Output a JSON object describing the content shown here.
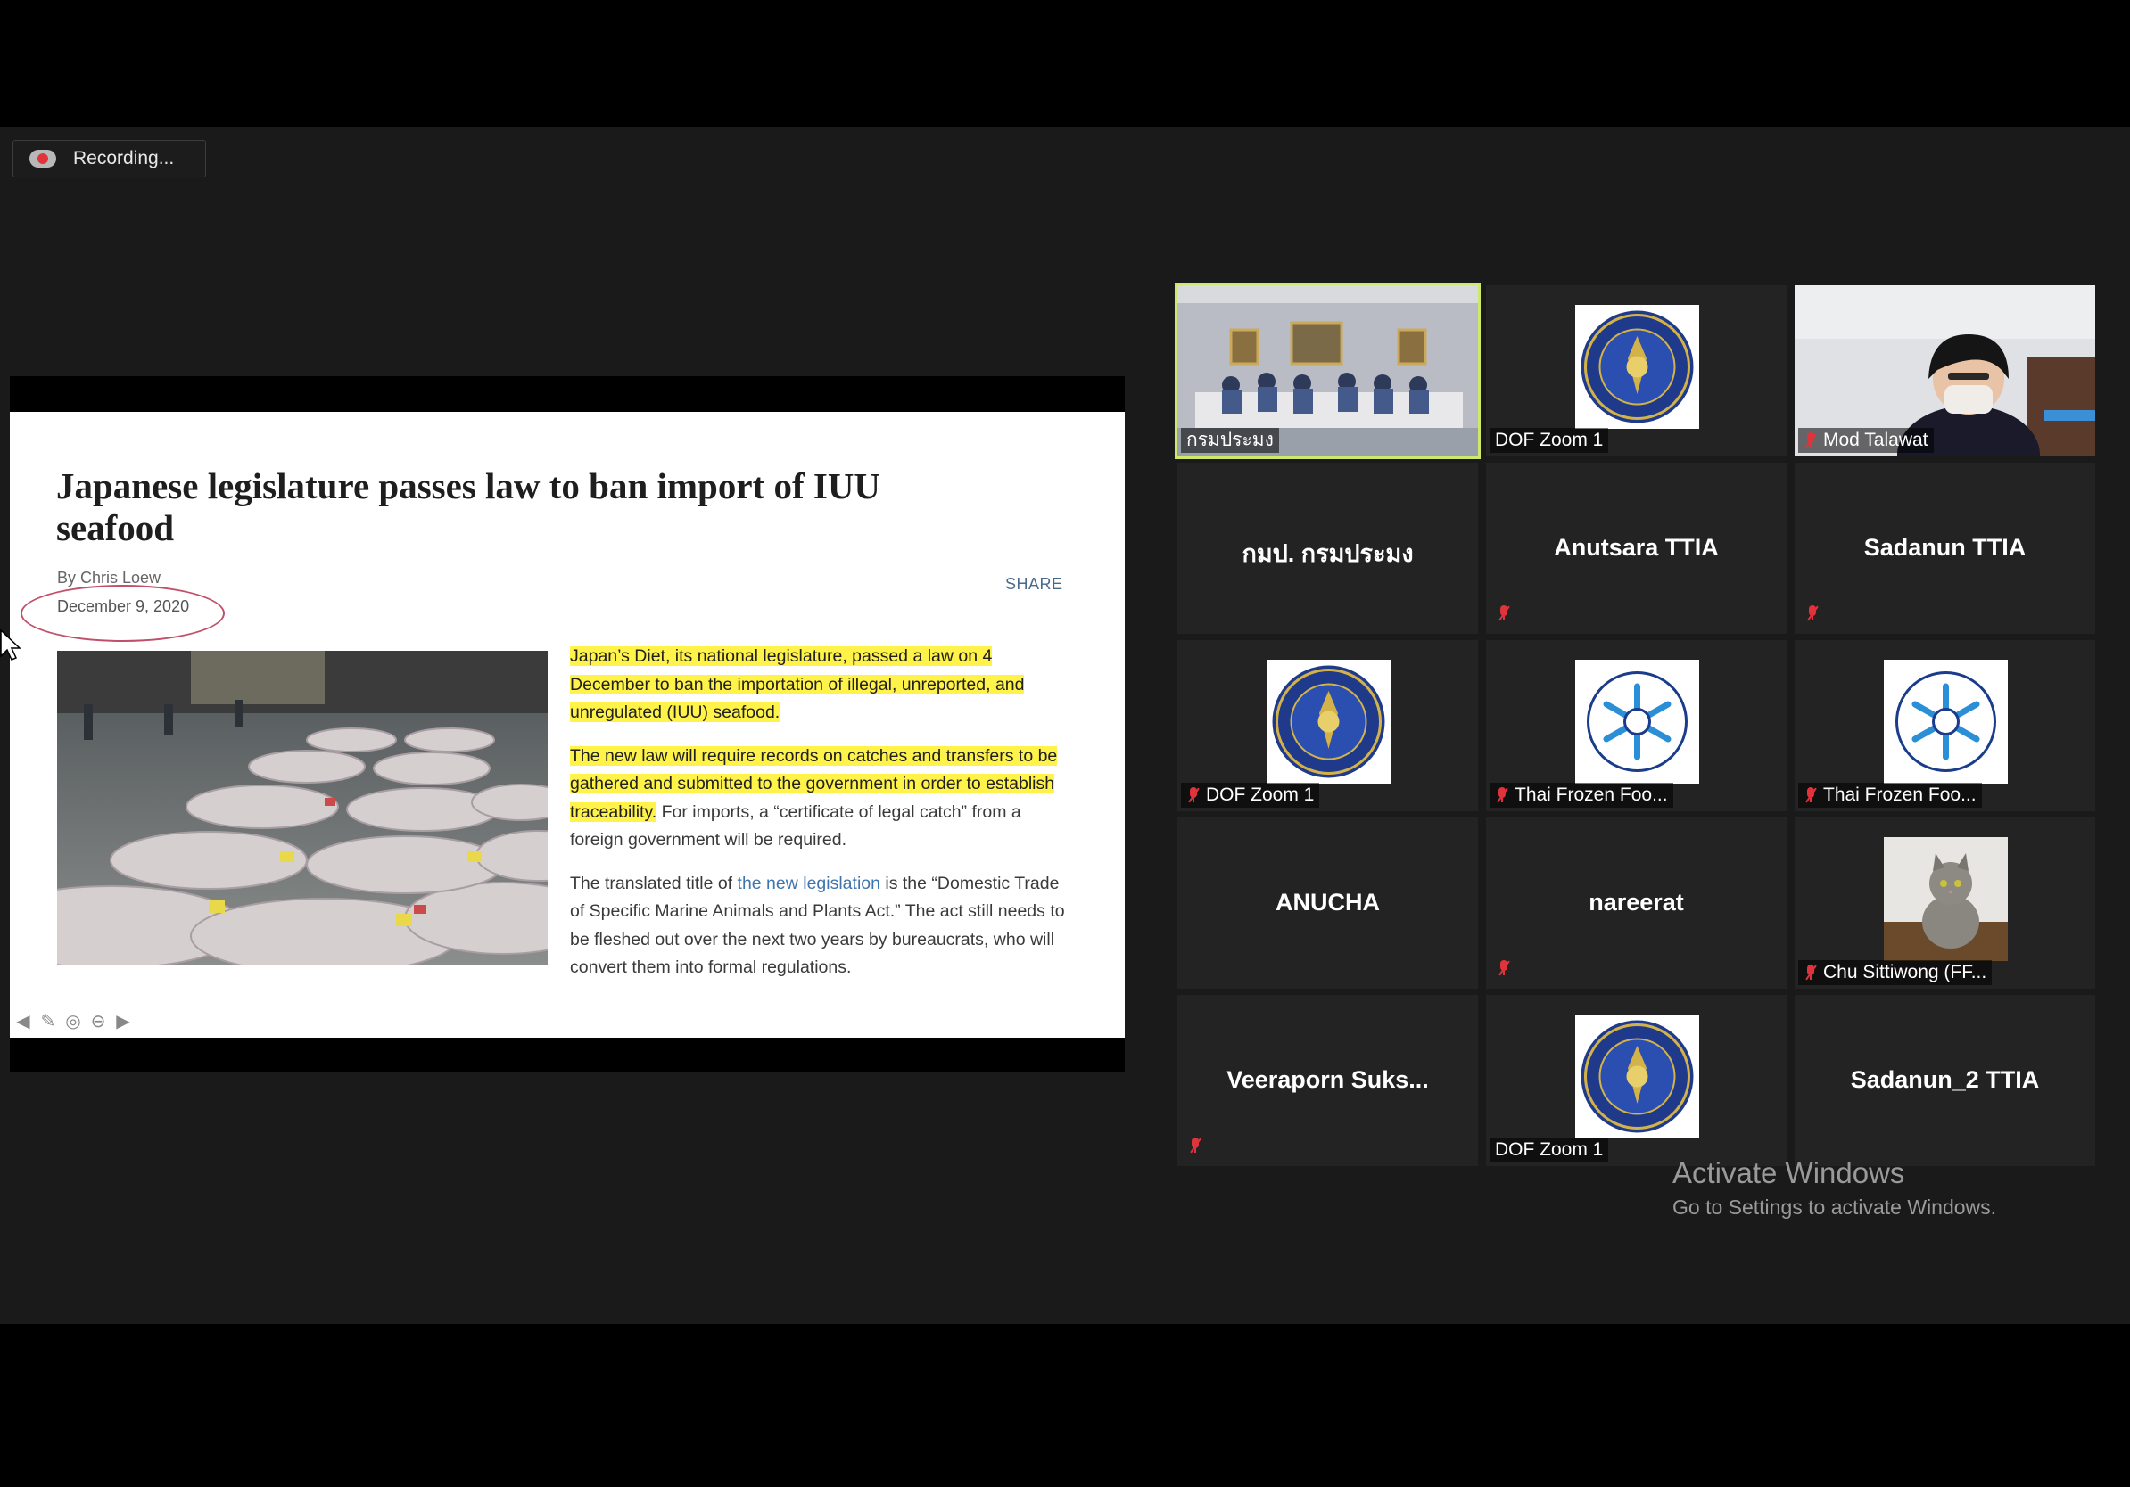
{
  "recording": {
    "label": "Recording..."
  },
  "article": {
    "title": "Japanese legislature passes law to ban import of IUU seafood",
    "byline_prefix": "By ",
    "author": "Chris Loew",
    "date": "December 9, 2020",
    "share": "SHARE",
    "p1_highlight": "Japan’s Diet, its national legislature, passed a law on 4 December to ban the importation of illegal, unreported, and unregulated (IUU) seafood.",
    "p2_highlight": "The new law will require records on catches and transfers to be gathered and submitted to the government in order to establish traceability.",
    "p2_rest": " For imports, a “certificate of legal catch” from a foreign government will be required.",
    "p3_before": "The translated title of ",
    "p3_link": "the new legislation",
    "p3_after": " is the “Domestic Trade of Specific Marine Animals and Plants Act.” The act still needs to be fleshed out over the next two years by bureaucrats, who will convert them into formal regulations."
  },
  "annotation_tools": [
    "arrow-left-icon",
    "pen-icon",
    "stamp-icon",
    "eraser-icon",
    "arrow-right-icon"
  ],
  "gallery": {
    "tiles": [
      {
        "name": "กรมประมง",
        "kind": "video-room",
        "muted": false,
        "active": true
      },
      {
        "name": "DOF Zoom 1",
        "kind": "logo-dof",
        "muted": false
      },
      {
        "name": "Mod Talawat",
        "kind": "video-person",
        "muted": true
      },
      {
        "name": "กมป. กรมประมง",
        "kind": "name",
        "muted": false
      },
      {
        "name": "Anutsara TTIA",
        "kind": "name",
        "muted": true
      },
      {
        "name": "Sadanun TTIA",
        "kind": "name",
        "muted": true
      },
      {
        "name": "DOF Zoom 1",
        "kind": "logo-dof",
        "muted": true
      },
      {
        "name": "Thai Frozen Foo...",
        "kind": "logo-tffa",
        "muted": true
      },
      {
        "name": "Thai Frozen Foo...",
        "kind": "logo-tffa",
        "muted": true
      },
      {
        "name": "ANUCHA",
        "kind": "name",
        "muted": false
      },
      {
        "name": "nareerat",
        "kind": "name",
        "muted": true
      },
      {
        "name": "Chu Sittiwong (FF...",
        "kind": "photo-cat",
        "muted": true
      },
      {
        "name": "Veeraporn Suks...",
        "kind": "name",
        "muted": true
      },
      {
        "name": "DOF Zoom 1",
        "kind": "logo-dof",
        "muted": false
      },
      {
        "name": "Sadanun_2 TTIA",
        "kind": "name",
        "muted": false
      }
    ]
  },
  "watermark": {
    "line1": "Activate Windows",
    "line2": "Go to Settings to activate Windows."
  },
  "colors": {
    "active_speaker": "#cde86a",
    "muted_red": "#e0333c",
    "highlight": "#fff34a",
    "link": "#3d75b0"
  }
}
